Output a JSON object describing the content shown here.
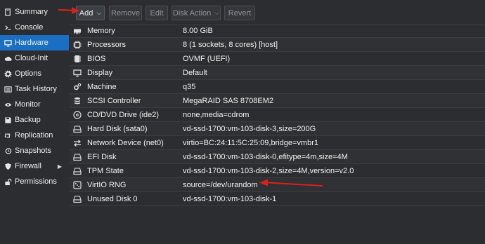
{
  "sidebar": {
    "items": [
      {
        "label": "Summary",
        "icon": "book-icon"
      },
      {
        "label": "Console",
        "icon": "terminal-icon"
      },
      {
        "label": "Hardware",
        "icon": "desktop-icon",
        "active": true
      },
      {
        "label": "Cloud-Init",
        "icon": "cloud-icon"
      },
      {
        "label": "Options",
        "icon": "gear-icon"
      },
      {
        "label": "Task History",
        "icon": "list-icon"
      },
      {
        "label": "Monitor",
        "icon": "eye-icon"
      },
      {
        "label": "Backup",
        "icon": "floppy-icon"
      },
      {
        "label": "Replication",
        "icon": "retweet-icon"
      },
      {
        "label": "Snapshots",
        "icon": "history-icon"
      },
      {
        "label": "Firewall",
        "icon": "shield-icon",
        "has_submenu": true
      },
      {
        "label": "Permissions",
        "icon": "unlock-icon"
      }
    ]
  },
  "toolbar": {
    "add_label": "Add",
    "remove_label": "Remove",
    "edit_label": "Edit",
    "disk_action_label": "Disk Action",
    "revert_label": "Revert"
  },
  "hardware": {
    "rows": [
      {
        "name": "Memory",
        "value": "8.00 GiB",
        "icon": "memory-icon"
      },
      {
        "name": "Processors",
        "value": "8 (1 sockets, 8 cores) [host]",
        "icon": "cpu-icon"
      },
      {
        "name": "BIOS",
        "value": "OVMF (UEFI)",
        "icon": "microchip-icon"
      },
      {
        "name": "Display",
        "value": "Default",
        "icon": "monitor-icon"
      },
      {
        "name": "Machine",
        "value": "q35",
        "icon": "cogs-icon"
      },
      {
        "name": "SCSI Controller",
        "value": "MegaRAID SAS 8708EM2",
        "icon": "database-icon"
      },
      {
        "name": "CD/DVD Drive (ide2)",
        "value": "none,media=cdrom",
        "icon": "cdrom-icon"
      },
      {
        "name": "Hard Disk (sata0)",
        "value": "vd-ssd-1700:vm-103-disk-3,size=200G",
        "icon": "hdd-icon"
      },
      {
        "name": "Network Device (net0)",
        "value": "virtio=BC:24:11:5C:25:09,bridge=vmbr1",
        "icon": "exchange-icon"
      },
      {
        "name": "EFI Disk",
        "value": "vd-ssd-1700:vm-103-disk-0,efitype=4m,size=4M",
        "icon": "hdd-icon"
      },
      {
        "name": "TPM State",
        "value": "vd-ssd-1700:vm-103-disk-2,size=4M,version=v2.0",
        "icon": "hdd-icon"
      },
      {
        "name": "VirtIO RNG",
        "value": "source=/dev/urandom",
        "icon": "dice-icon"
      },
      {
        "name": "Unused Disk 0",
        "value": "vd-ssd-1700:vm-103-disk-1",
        "icon": "hdd-icon"
      }
    ]
  },
  "colors": {
    "background": "#2b2d30",
    "active": "#1a6fc3",
    "annotation_arrow": "#d9211c"
  }
}
